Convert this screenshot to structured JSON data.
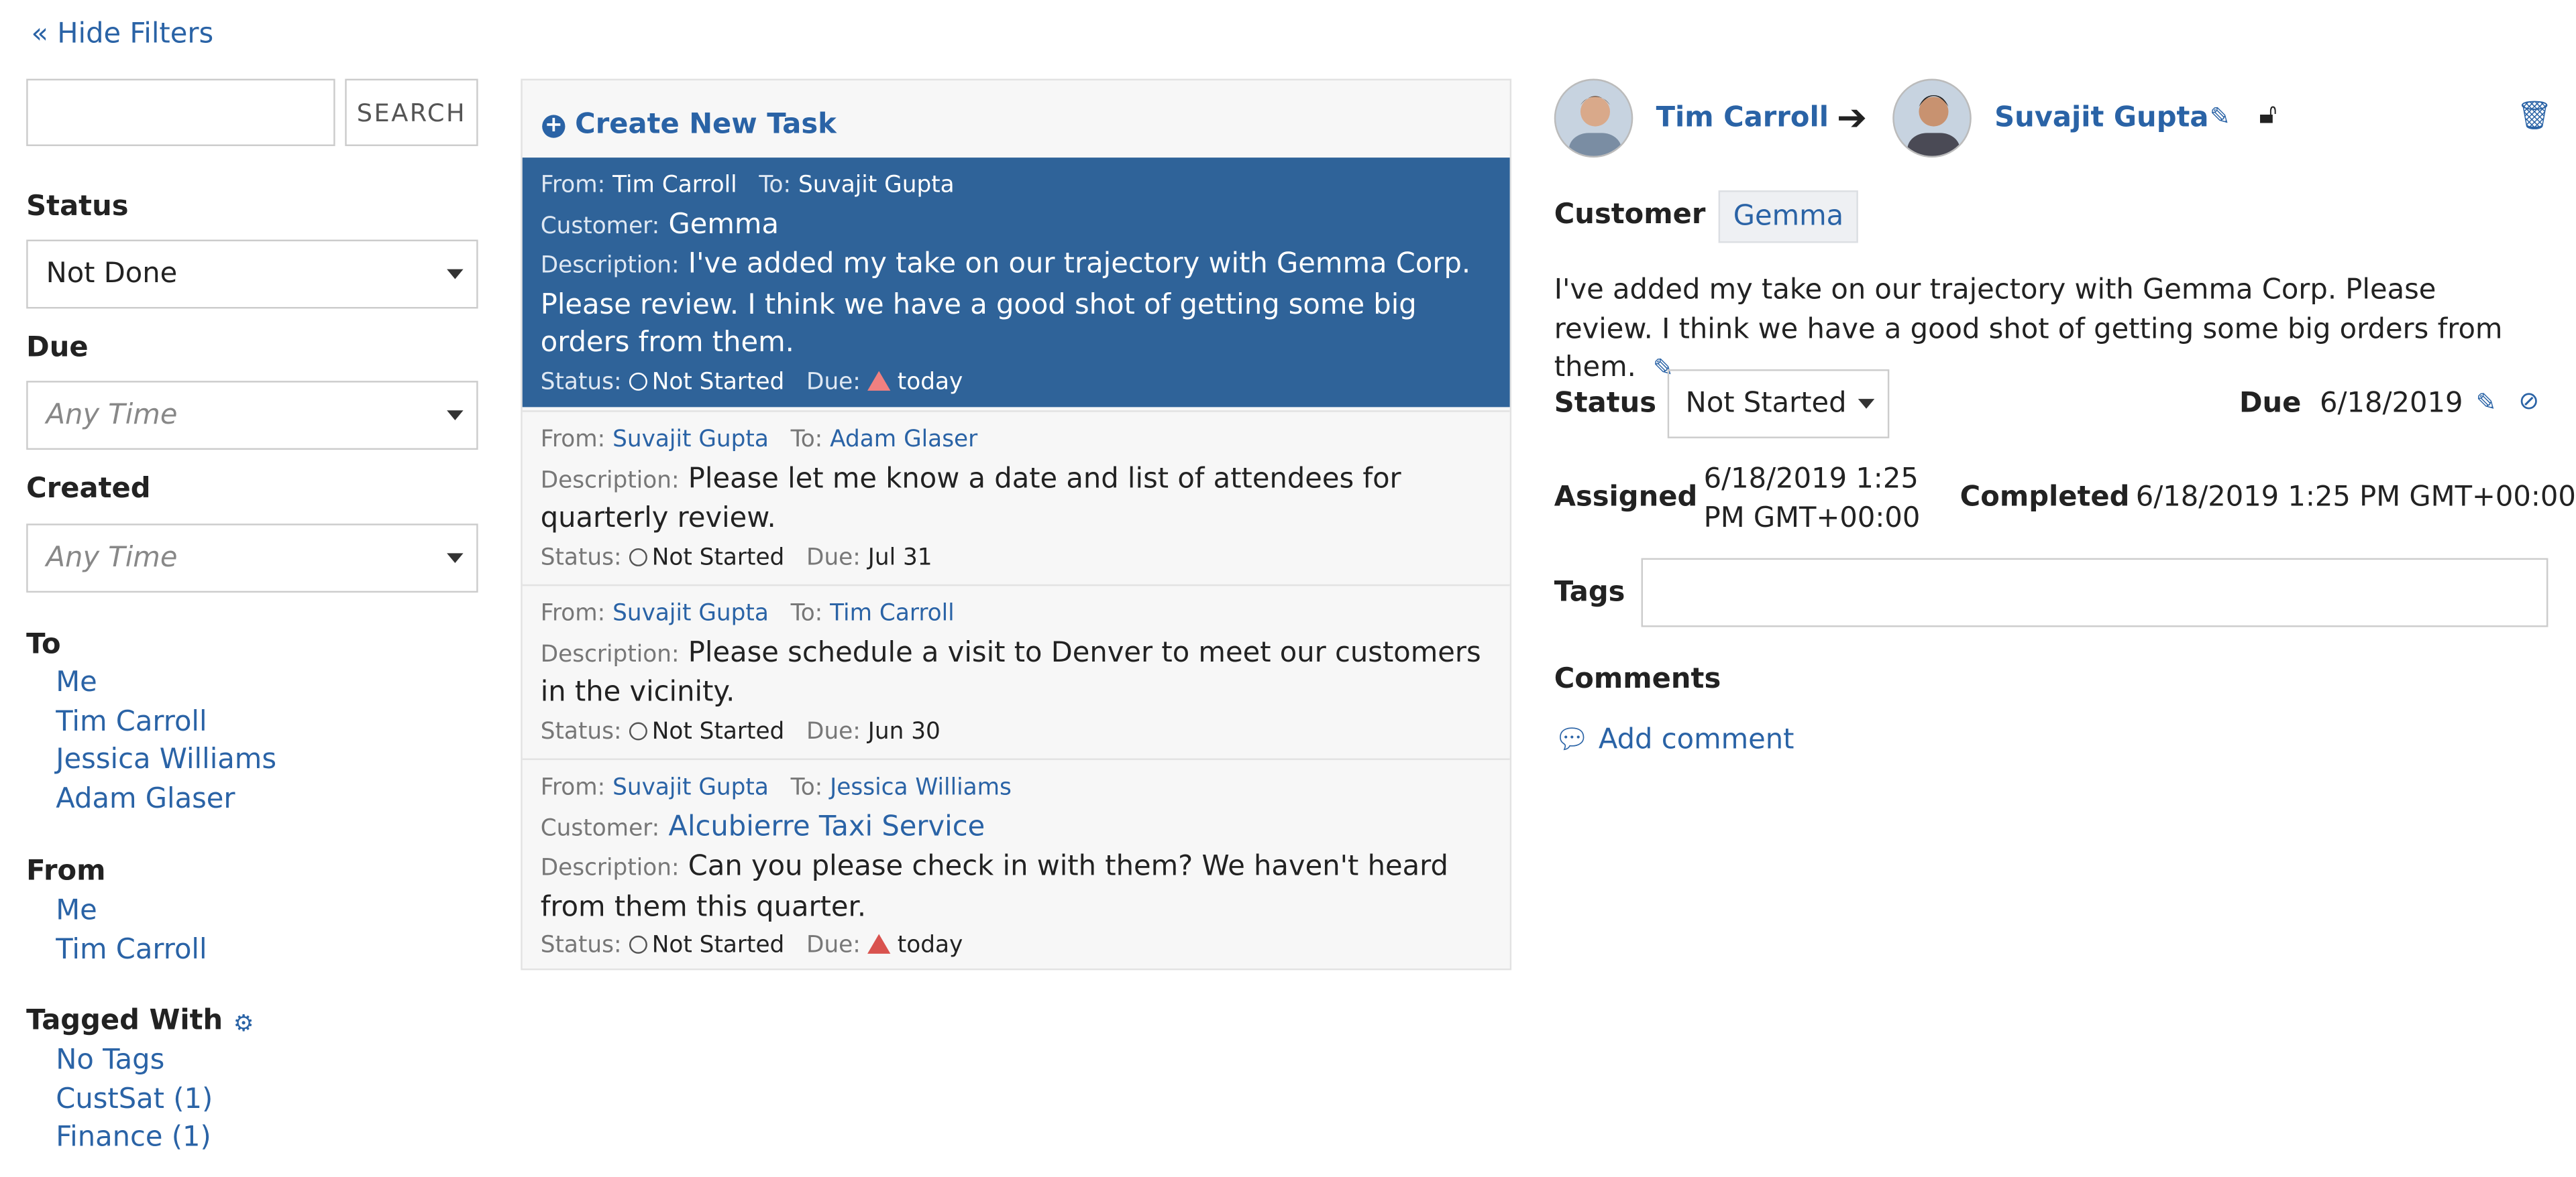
{
  "filters": {
    "hide_label": "« Hide Filters",
    "search_value": "",
    "search_button": "SEARCH",
    "status_label": "Status",
    "status_value": "Not Done",
    "due_label": "Due",
    "due_placeholder": "Any Time",
    "created_label": "Created",
    "created_placeholder": "Any Time",
    "to_label": "To",
    "to_items": [
      "Me",
      "Tim Carroll",
      "Jessica Williams",
      "Adam Glaser"
    ],
    "from_label": "From",
    "from_items": [
      "Me",
      "Tim Carroll"
    ],
    "tagged_label": "Tagged With",
    "tag_items": [
      "No Tags",
      "CustSat (1)",
      "Finance (1)"
    ]
  },
  "tasks": {
    "create_label": "Create New Task",
    "field_from": "From:",
    "field_to": "To:",
    "field_customer": "Customer:",
    "field_description": "Description:",
    "field_status": "Status:",
    "field_due": "Due:",
    "items": [
      {
        "from": "Tim Carroll",
        "to": "Suvajit Gupta",
        "customer": "Gemma",
        "description": "I've added my take on our trajectory with Gemma Corp. Please review. I think we have a good shot of getting some big orders from them.",
        "status": "Not Started",
        "due": "today"
      },
      {
        "from": "Suvajit Gupta",
        "to": "Adam Glaser",
        "description": "Please let me know a date and list of attendees for quarterly review.",
        "status": "Not Started",
        "due": "Jul 31"
      },
      {
        "from": "Suvajit Gupta",
        "to": "Tim Carroll",
        "description": "Please schedule a visit to Denver to meet our customers in the vicinity.",
        "status": "Not Started",
        "due": "Jun 30"
      },
      {
        "from": "Suvajit Gupta",
        "to": "Jessica Williams",
        "customer": "Alcubierre Taxi Service",
        "description": "Can you please check in with them? We haven't heard from them this quarter.",
        "status": "Not Started",
        "due": "today"
      }
    ]
  },
  "detail": {
    "from_user": "Tim Carroll",
    "to_user": "Suvajit Gupta",
    "customer_label": "Customer",
    "customer_value": "Gemma",
    "description": "I've added my take on our trajectory with Gemma Corp. Please review. I think we have a good shot of getting some big orders from them.",
    "status_label": "Status",
    "status_value": "Not Started",
    "due_label": "Due",
    "due_value": "6/18/2019",
    "assigned_label": "Assigned",
    "assigned_value": "6/18/2019 1:25 PM GMT+00:00",
    "completed_label": "Completed",
    "completed_value": "6/18/2019 1:25 PM GMT+00:00",
    "tags_label": "Tags",
    "tags_value": "",
    "comments_label": "Comments",
    "add_comment": "Add comment"
  }
}
